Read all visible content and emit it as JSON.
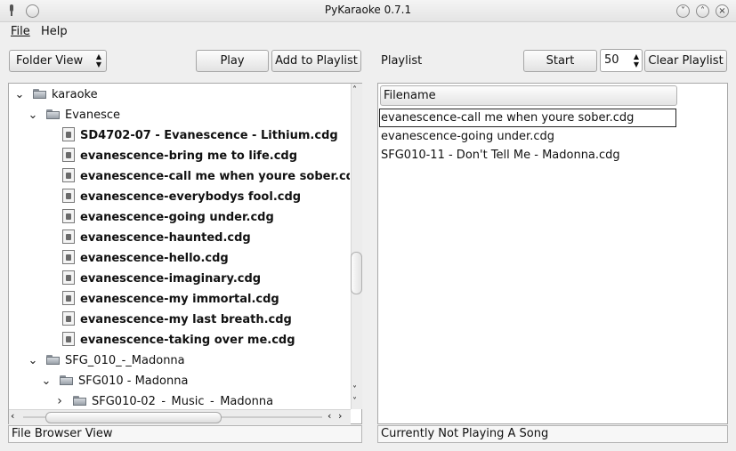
{
  "window": {
    "title": "PyKaraoke 0.7.1"
  },
  "menu": {
    "file": "File",
    "help": "Help"
  },
  "toolbar": {
    "view_select": "Folder View",
    "play": "Play",
    "add_to_playlist": "Add to Playlist",
    "playlist_label": "Playlist",
    "start": "Start",
    "volume": "50",
    "clear_playlist": "Clear Playlist"
  },
  "tree": [
    {
      "label": "karaoke",
      "type": "folder",
      "expanded": true,
      "level": 0
    },
    {
      "label": "Evanesce",
      "type": "folder",
      "expanded": true,
      "level": 1
    },
    {
      "label": "SD4702-07 - Evanescence - Lithium.cdg",
      "type": "file",
      "level": 2
    },
    {
      "label": "evanescence-bring me to life.cdg",
      "type": "file",
      "level": 2
    },
    {
      "label": "evanescence-call me when youre sober.cdg",
      "type": "file",
      "level": 2
    },
    {
      "label": "evanescence-everybodys fool.cdg",
      "type": "file",
      "level": 2
    },
    {
      "label": "evanescence-going under.cdg",
      "type": "file",
      "level": 2
    },
    {
      "label": "evanescence-haunted.cdg",
      "type": "file",
      "level": 2
    },
    {
      "label": "evanescence-hello.cdg",
      "type": "file",
      "level": 2
    },
    {
      "label": "evanescence-imaginary.cdg",
      "type": "file",
      "level": 2
    },
    {
      "label": "evanescence-my immortal.cdg",
      "type": "file",
      "level": 2
    },
    {
      "label": "evanescence-my last breath.cdg",
      "type": "file",
      "level": 2
    },
    {
      "label": "evanescence-taking over me.cdg",
      "type": "file",
      "level": 2
    },
    {
      "label": "SFG_010_-_Madonna",
      "type": "folder",
      "expanded": true,
      "level": 1
    },
    {
      "label": "SFG010 - Madonna",
      "type": "folder",
      "expanded": true,
      "level": 2
    },
    {
      "label": "SFG010-02_-_Music_-_Madonna",
      "type": "folder",
      "expanded": false,
      "level": 3
    }
  ],
  "playlist": {
    "column_header": "Filename",
    "items": [
      "evanescence-call me when youre sober.cdg",
      "evanescence-going under.cdg",
      "SFG010-11 - Don't Tell Me - Madonna.cdg"
    ]
  },
  "status": {
    "left": "File Browser View",
    "right": "Currently Not Playing A Song"
  }
}
